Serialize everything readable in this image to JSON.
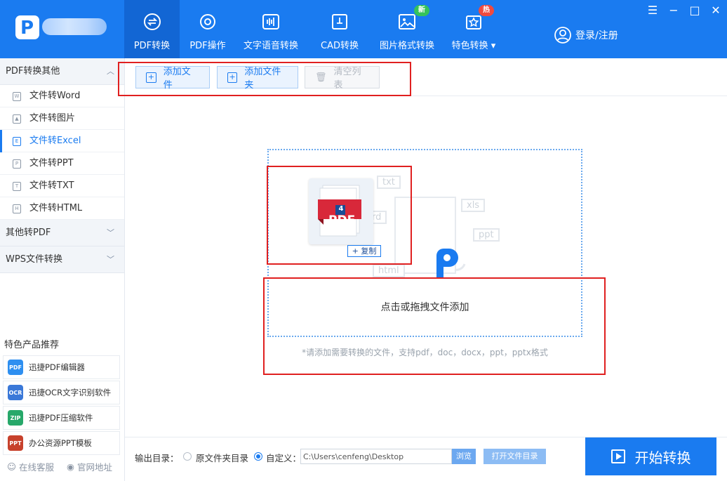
{
  "nav": {
    "items": [
      {
        "label": "PDF转换",
        "icon": "convert-icon",
        "active": true
      },
      {
        "label": "PDF操作",
        "icon": "gear-icon"
      },
      {
        "label": "文字语音转换",
        "icon": "voice-wave-icon"
      },
      {
        "label": "CAD转换",
        "icon": "cad-icon"
      },
      {
        "label": "图片格式转换",
        "icon": "image-icon"
      },
      {
        "label": "特色转换",
        "icon": "star-icon"
      }
    ],
    "badge_new": "新",
    "badge_hot": "热",
    "login": "登录/注册"
  },
  "window": {
    "menu": "☰",
    "minimize": "−",
    "maximize": "□",
    "close": "✕"
  },
  "sidebar": {
    "section1": "PDF转换其他",
    "items": [
      {
        "label": "文件转Word",
        "glyph": "W"
      },
      {
        "label": "文件转图片",
        "glyph": "▲"
      },
      {
        "label": "文件转Excel",
        "glyph": "E",
        "active": true
      },
      {
        "label": "文件转PPT",
        "glyph": "P"
      },
      {
        "label": "文件转TXT",
        "glyph": "T"
      },
      {
        "label": "文件转HTML",
        "glyph": "H"
      }
    ],
    "section2": "其他转PDF",
    "section3": "WPS文件转换",
    "rec_title": "特色产品推荐",
    "rec_items": [
      {
        "label": "迅捷PDF编辑器",
        "glyph": "PDF",
        "color": "#2e8ff0"
      },
      {
        "label": "迅捷OCR文字识别软件",
        "glyph": "OCR",
        "color": "#3a78d8"
      },
      {
        "label": "迅捷PDF压缩软件",
        "glyph": "ZIP",
        "color": "#27a86a"
      },
      {
        "label": "办公资源PPT模板",
        "glyph": "PPT",
        "color": "#c7412c"
      }
    ],
    "support": "在线客服",
    "website": "官网地址"
  },
  "toolbar": {
    "add_file": "添加文件",
    "add_folder": "添加文件夹",
    "clear": "清空列表"
  },
  "dropzone": {
    "tags": [
      "txt",
      "ord",
      "xls",
      "ppt",
      "html"
    ],
    "pdf_label": "PDF",
    "page_count": "4",
    "copy": "+ 复制",
    "main_text": "点击或拖拽文件添加",
    "hint": "*请添加需要转换的文件，支持pdf，doc，docx，ppt，pptx格式"
  },
  "bottom": {
    "output_label": "输出目录：",
    "opt_original": "原文件夹目录",
    "opt_custom": "自定义：",
    "path": "C:\\Users\\cenfeng\\Desktop",
    "browse": "浏览",
    "open_dir": "打开文件目录",
    "start": "开始转换"
  },
  "colors": {
    "brand": "#1a7bf0",
    "highlight": "#e02020"
  }
}
